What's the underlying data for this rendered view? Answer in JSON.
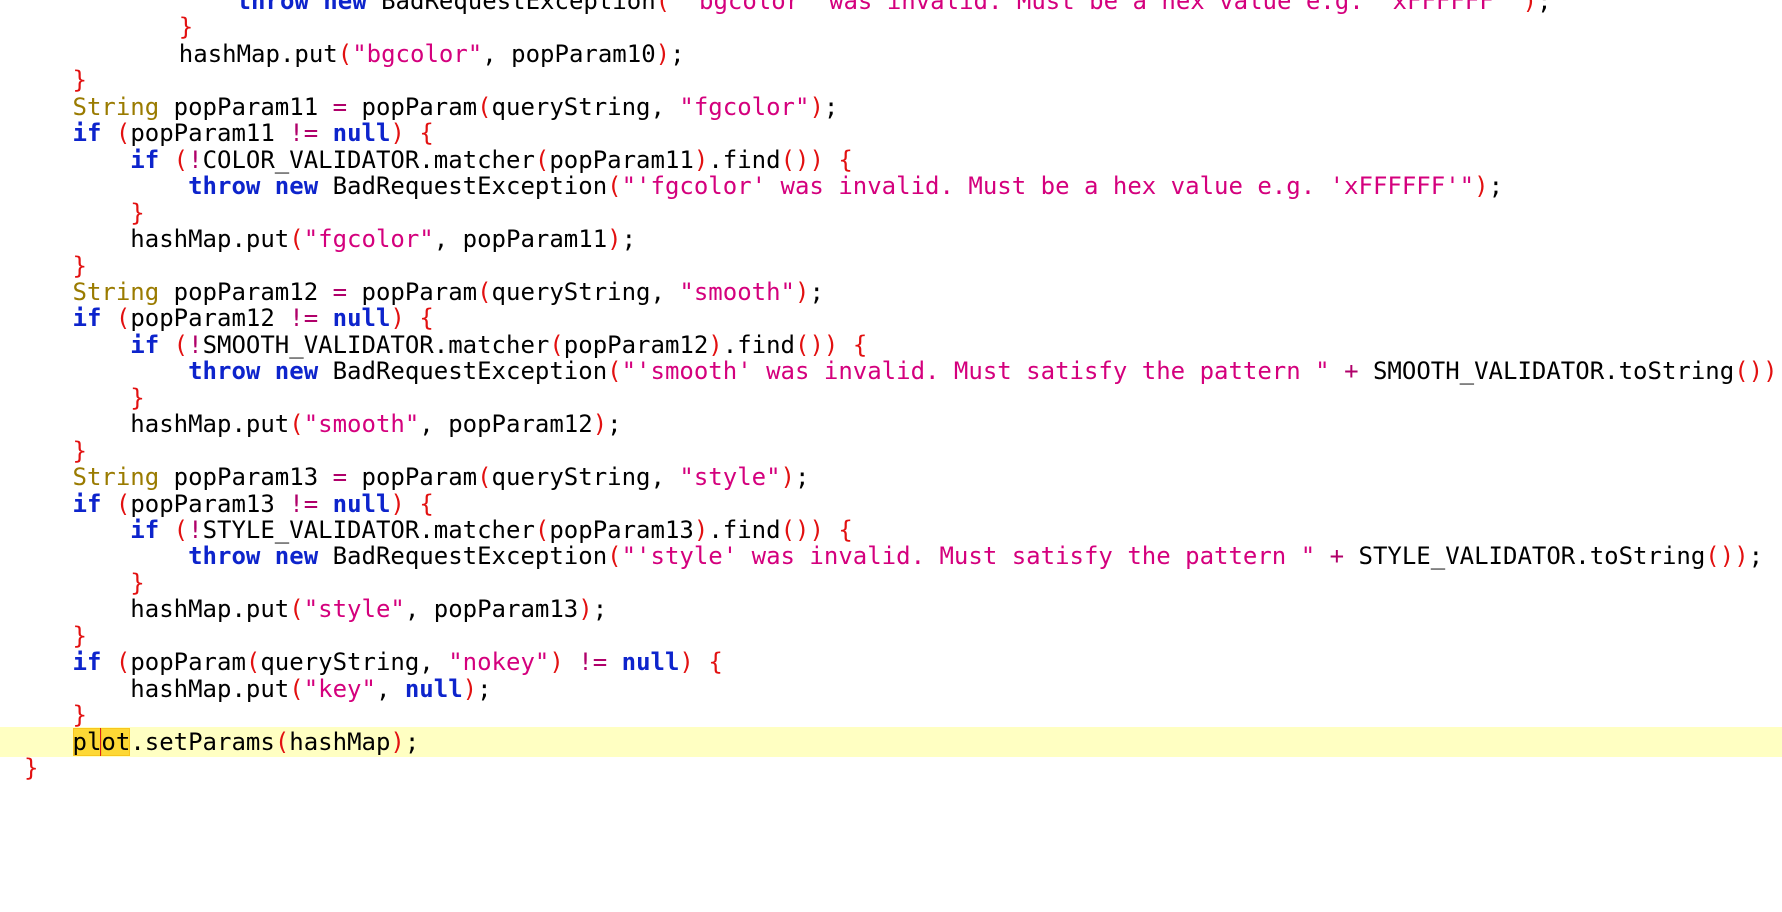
{
  "editor": {
    "current_line_index": 28,
    "colors": {
      "keyword": "#0d24cc",
      "type": "#9a7b00",
      "string": "#d4007d",
      "brace": "#e21010",
      "current_line_bg": "#ffffc2",
      "search_highlight": "#fdd835"
    },
    "lines": [
      [
        [
          "        ",
          "plain"
        ],
        [
          "throw",
          "kw"
        ],
        [
          " ",
          "plain"
        ],
        [
          "new",
          "kw"
        ],
        [
          " BadRequestException",
          "plain"
        ],
        [
          "(",
          "brace"
        ],
        [
          "\"'bgcolor' was invalid. Must be a hex value e.g. 'xFFFFFF'\"",
          "str"
        ],
        [
          ")",
          "brace"
        ],
        [
          ";",
          "plain"
        ]
      ],
      [
        [
          "    ",
          "plain"
        ],
        [
          "}",
          "brace"
        ]
      ],
      [
        [
          "    hashMap.put",
          "plain"
        ],
        [
          "(",
          "brace"
        ],
        [
          "\"bgcolor\"",
          "str"
        ],
        [
          ", popParam10",
          "plain"
        ],
        [
          ")",
          "brace"
        ],
        [
          ";",
          "plain"
        ]
      ],
      [
        [
          "}",
          "brace"
        ]
      ],
      [
        [
          "String",
          "type"
        ],
        [
          " popParam11 ",
          "plain"
        ],
        [
          "=",
          "op"
        ],
        [
          " popParam",
          "plain"
        ],
        [
          "(",
          "brace"
        ],
        [
          "queryString, ",
          "plain"
        ],
        [
          "\"fgcolor\"",
          "str"
        ],
        [
          ")",
          "brace"
        ],
        [
          ";",
          "plain"
        ]
      ],
      [
        [
          "if",
          "kw"
        ],
        [
          " ",
          "plain"
        ],
        [
          "(",
          "brace"
        ],
        [
          "popParam11 ",
          "plain"
        ],
        [
          "!=",
          "op"
        ],
        [
          " ",
          "plain"
        ],
        [
          "null",
          "kw"
        ],
        [
          ")",
          "brace"
        ],
        [
          " ",
          "plain"
        ],
        [
          "{",
          "brace"
        ]
      ],
      [
        [
          "    ",
          "plain"
        ],
        [
          "if",
          "kw"
        ],
        [
          " ",
          "plain"
        ],
        [
          "(",
          "brace"
        ],
        [
          "!",
          "op"
        ],
        [
          "COLOR_VALIDATOR.matcher",
          "plain"
        ],
        [
          "(",
          "brace"
        ],
        [
          "popParam11",
          "plain"
        ],
        [
          ")",
          "brace"
        ],
        [
          ".find",
          "plain"
        ],
        [
          "()",
          "brace"
        ],
        [
          ")",
          "brace"
        ],
        [
          " ",
          "plain"
        ],
        [
          "{",
          "brace"
        ]
      ],
      [
        [
          "        ",
          "plain"
        ],
        [
          "throw",
          "kw"
        ],
        [
          " ",
          "plain"
        ],
        [
          "new",
          "kw"
        ],
        [
          " BadRequestException",
          "plain"
        ],
        [
          "(",
          "brace"
        ],
        [
          "\"'fgcolor' was invalid. Must be a hex value e.g. 'xFFFFFF'\"",
          "str"
        ],
        [
          ")",
          "brace"
        ],
        [
          ";",
          "plain"
        ]
      ],
      [
        [
          "    ",
          "plain"
        ],
        [
          "}",
          "brace"
        ]
      ],
      [
        [
          "    hashMap.put",
          "plain"
        ],
        [
          "(",
          "brace"
        ],
        [
          "\"fgcolor\"",
          "str"
        ],
        [
          ", popParam11",
          "plain"
        ],
        [
          ")",
          "brace"
        ],
        [
          ";",
          "plain"
        ]
      ],
      [
        [
          "}",
          "brace"
        ]
      ],
      [
        [
          "String",
          "type"
        ],
        [
          " popParam12 ",
          "plain"
        ],
        [
          "=",
          "op"
        ],
        [
          " popParam",
          "plain"
        ],
        [
          "(",
          "brace"
        ],
        [
          "queryString, ",
          "plain"
        ],
        [
          "\"smooth\"",
          "str"
        ],
        [
          ")",
          "brace"
        ],
        [
          ";",
          "plain"
        ]
      ],
      [
        [
          "if",
          "kw"
        ],
        [
          " ",
          "plain"
        ],
        [
          "(",
          "brace"
        ],
        [
          "popParam12 ",
          "plain"
        ],
        [
          "!=",
          "op"
        ],
        [
          " ",
          "plain"
        ],
        [
          "null",
          "kw"
        ],
        [
          ")",
          "brace"
        ],
        [
          " ",
          "plain"
        ],
        [
          "{",
          "brace"
        ]
      ],
      [
        [
          "    ",
          "plain"
        ],
        [
          "if",
          "kw"
        ],
        [
          " ",
          "plain"
        ],
        [
          "(",
          "brace"
        ],
        [
          "!",
          "op"
        ],
        [
          "SMOOTH_VALIDATOR.matcher",
          "plain"
        ],
        [
          "(",
          "brace"
        ],
        [
          "popParam12",
          "plain"
        ],
        [
          ")",
          "brace"
        ],
        [
          ".find",
          "plain"
        ],
        [
          "()",
          "brace"
        ],
        [
          ")",
          "brace"
        ],
        [
          " ",
          "plain"
        ],
        [
          "{",
          "brace"
        ]
      ],
      [
        [
          "        ",
          "plain"
        ],
        [
          "throw",
          "kw"
        ],
        [
          " ",
          "plain"
        ],
        [
          "new",
          "kw"
        ],
        [
          " BadRequestException",
          "plain"
        ],
        [
          "(",
          "brace"
        ],
        [
          "\"'smooth' was invalid. Must satisfy the pattern \"",
          "str"
        ],
        [
          " ",
          "plain"
        ],
        [
          "+",
          "op"
        ],
        [
          " SMOOTH_VALIDATOR.toString",
          "plain"
        ],
        [
          "())",
          "brace"
        ],
        [
          ";",
          "plain"
        ]
      ],
      [
        [
          "    ",
          "plain"
        ],
        [
          "}",
          "brace"
        ]
      ],
      [
        [
          "    hashMap.put",
          "plain"
        ],
        [
          "(",
          "brace"
        ],
        [
          "\"smooth\"",
          "str"
        ],
        [
          ", popParam12",
          "plain"
        ],
        [
          ")",
          "brace"
        ],
        [
          ";",
          "plain"
        ]
      ],
      [
        [
          "}",
          "brace"
        ]
      ],
      [
        [
          "String",
          "type"
        ],
        [
          " popParam13 ",
          "plain"
        ],
        [
          "=",
          "op"
        ],
        [
          " popParam",
          "plain"
        ],
        [
          "(",
          "brace"
        ],
        [
          "queryString, ",
          "plain"
        ],
        [
          "\"style\"",
          "str"
        ],
        [
          ")",
          "brace"
        ],
        [
          ";",
          "plain"
        ]
      ],
      [
        [
          "if",
          "kw"
        ],
        [
          " ",
          "plain"
        ],
        [
          "(",
          "brace"
        ],
        [
          "popParam13 ",
          "plain"
        ],
        [
          "!=",
          "op"
        ],
        [
          " ",
          "plain"
        ],
        [
          "null",
          "kw"
        ],
        [
          ")",
          "brace"
        ],
        [
          " ",
          "plain"
        ],
        [
          "{",
          "brace"
        ]
      ],
      [
        [
          "    ",
          "plain"
        ],
        [
          "if",
          "kw"
        ],
        [
          " ",
          "plain"
        ],
        [
          "(",
          "brace"
        ],
        [
          "!",
          "op"
        ],
        [
          "STYLE_VALIDATOR.matcher",
          "plain"
        ],
        [
          "(",
          "brace"
        ],
        [
          "popParam13",
          "plain"
        ],
        [
          ")",
          "brace"
        ],
        [
          ".find",
          "plain"
        ],
        [
          "()",
          "brace"
        ],
        [
          ")",
          "brace"
        ],
        [
          " ",
          "plain"
        ],
        [
          "{",
          "brace"
        ]
      ],
      [
        [
          "        ",
          "plain"
        ],
        [
          "throw",
          "kw"
        ],
        [
          " ",
          "plain"
        ],
        [
          "new",
          "kw"
        ],
        [
          " BadRequestException",
          "plain"
        ],
        [
          "(",
          "brace"
        ],
        [
          "\"'style' was invalid. Must satisfy the pattern \"",
          "str"
        ],
        [
          " ",
          "plain"
        ],
        [
          "+",
          "op"
        ],
        [
          " STYLE_VALIDATOR.toString",
          "plain"
        ],
        [
          "())",
          "brace"
        ],
        [
          ";",
          "plain"
        ]
      ],
      [
        [
          "    ",
          "plain"
        ],
        [
          "}",
          "brace"
        ]
      ],
      [
        [
          "    hashMap.put",
          "plain"
        ],
        [
          "(",
          "brace"
        ],
        [
          "\"style\"",
          "str"
        ],
        [
          ", popParam13",
          "plain"
        ],
        [
          ")",
          "brace"
        ],
        [
          ";",
          "plain"
        ]
      ],
      [
        [
          "}",
          "brace"
        ]
      ],
      [
        [
          "if",
          "kw"
        ],
        [
          " ",
          "plain"
        ],
        [
          "(",
          "brace"
        ],
        [
          "popParam",
          "plain"
        ],
        [
          "(",
          "brace"
        ],
        [
          "queryString, ",
          "plain"
        ],
        [
          "\"nokey\"",
          "str"
        ],
        [
          ")",
          "brace"
        ],
        [
          " ",
          "plain"
        ],
        [
          "!=",
          "op"
        ],
        [
          " ",
          "plain"
        ],
        [
          "null",
          "kw"
        ],
        [
          ")",
          "brace"
        ],
        [
          " ",
          "plain"
        ],
        [
          "{",
          "brace"
        ]
      ],
      [
        [
          "    hashMap.put",
          "plain"
        ],
        [
          "(",
          "brace"
        ],
        [
          "\"key\"",
          "str"
        ],
        [
          ", ",
          "plain"
        ],
        [
          "null",
          "kw"
        ],
        [
          ")",
          "brace"
        ],
        [
          ";",
          "plain"
        ]
      ],
      [
        [
          "}",
          "brace"
        ]
      ],
      [
        [
          "pl",
          "hl"
        ],
        [
          "|",
          "caret"
        ],
        [
          "ot",
          "hl"
        ],
        [
          ".setParams",
          "plain"
        ],
        [
          "(",
          "brace"
        ],
        [
          "hashMap",
          "plain"
        ],
        [
          ")",
          "brace"
        ],
        [
          ";",
          "plain"
        ]
      ],
      [
        [
          "}",
          "brace"
        ]
      ]
    ],
    "indents": [
      2,
      2,
      2,
      1,
      1,
      1,
      1,
      1,
      1,
      1,
      1,
      1,
      1,
      1,
      1,
      1,
      1,
      1,
      1,
      1,
      1,
      1,
      1,
      1,
      1,
      1,
      1,
      1,
      1,
      0
    ]
  }
}
